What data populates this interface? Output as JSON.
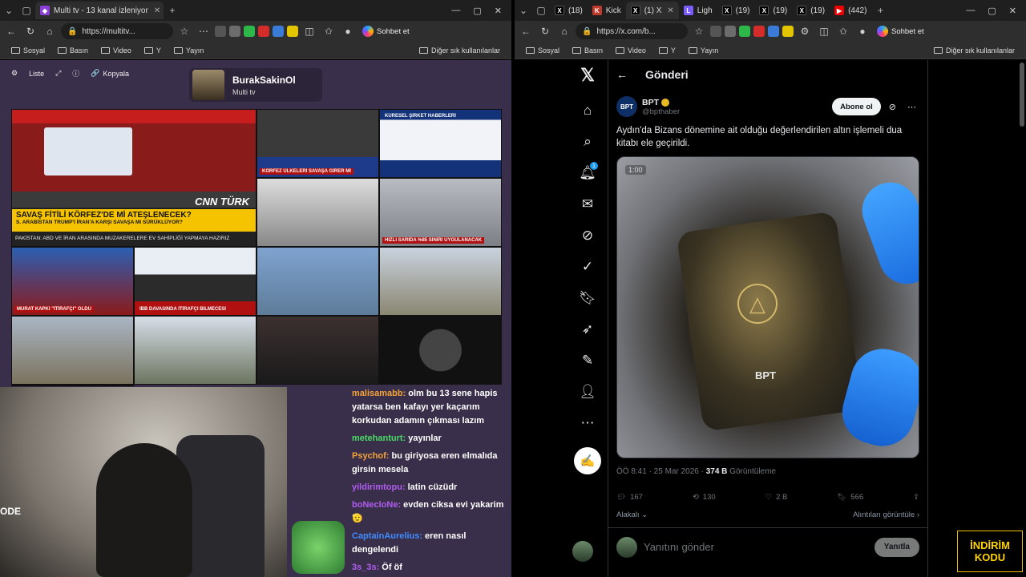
{
  "left": {
    "active_tab": "Multi tv - 13 kanal izleniyor",
    "url": "https://multitv...",
    "copilot": "Sohbet et",
    "bookmarks": [
      "Sosyal",
      "Basın",
      "Video",
      "Y",
      "Yayın"
    ],
    "bookmarks_right": "Diğer sık kullanılanlar",
    "multitv": {
      "list_label": "Liste",
      "copy_label": "Kopyala",
      "user_name": "BurakSakinOl",
      "user_sub": "Multi tv"
    },
    "tiles": {
      "cnn_headline": "SAVAŞ FİTİLİ KÖRFEZ'DE Mİ ATEŞLENECEK?",
      "cnn_sub": "S. ARABİSTAN TRUMP'I İRAN'A KARŞI SAVAŞA MI SÜRÜKLÜYOR?",
      "cnn_ticker": "PAKİSTAN: ABD VE İRAN ARASINDA MUZAKERELERE EV SAHİPLİĞİ YAPMAYA HAZIRIZ",
      "cnn_logo": "CNN TÜRK",
      "t2_cap": "KÖRFEZ ÜLKELERİ SAVAŞA GİRER Mİ",
      "t3_cap": "KÜRESEL ŞİRKET HABERLERİ",
      "t5_cap": "HIZLI SARIDA %85 SINIRI UYGULANACAK",
      "t6_cap": "MURAT KAPKİ \"İTİRAFÇI\" OLDU",
      "t7_cap": "İBB DAVASINDA İTİRAFÇI BİLMECESİ"
    },
    "webcam_mic": "ODE",
    "chat": [
      {
        "user": "malisamabb:",
        "text": "olm bu 13 sene hapis yatarsa ben kafayı yer kaçarım korkudan adamın çıkması lazım",
        "color": "#f2a33a"
      },
      {
        "user": "metehanturt:",
        "text": "yayınlar",
        "color": "#4cd964"
      },
      {
        "user": "Psychof:",
        "text": "bu giriyosa eren elmalıda girsin mesela",
        "color": "#f2a33a"
      },
      {
        "user": "yildirimtopu:",
        "text": "latin cüzüdr",
        "color": "#b05cf0"
      },
      {
        "user": "boNecloNe:",
        "text": "evden ciksa evi yakarim 🫡",
        "color": "#b05cf0"
      },
      {
        "user": "CaptainAurelius:",
        "text": "eren nasıl dengelendi",
        "color": "#3f8cff"
      },
      {
        "user": "3s_3s:",
        "text": "Öf öf",
        "color": "#b05cf0"
      }
    ]
  },
  "right": {
    "tabs": [
      "(18)",
      "Kick",
      "(1) X",
      "Ligh",
      "(19)",
      "(19)",
      "(19)",
      "(442)"
    ],
    "url": "https://x.com/b...",
    "copilot": "Sohbet et",
    "bookmarks": [
      "Sosyal",
      "Basın",
      "Video",
      "Y",
      "Yayın"
    ],
    "bookmarks_right": "Diğer sık kullanılanlar",
    "header_title": "Gönderi",
    "notif_count": "1",
    "author_name": "BPT",
    "author_handle": "@bpthaber",
    "follow_label": "Abone ol",
    "tweet_text": "Aydın'da Bizans dönemine ait olduğu değerlendirilen altın işlemeli dua kitabı ele geçirildi.",
    "media_time": "1:00",
    "media_watermark": "BPT",
    "timestamp": "ÖÖ 8:41 · 25 Mar 2026 · ",
    "views_count": "374 B",
    "views_label": " Görüntüleme",
    "replies": "167",
    "reposts": "130",
    "likes": "2 B",
    "bookmarks_count": "566",
    "related": "Alakalı",
    "quotes": "Alıntıları görüntüle",
    "reply_placeholder": "Yanıtını gönder",
    "reply_button": "Yanıtla",
    "promo": [
      "İNDİRİM",
      "KODU"
    ]
  }
}
